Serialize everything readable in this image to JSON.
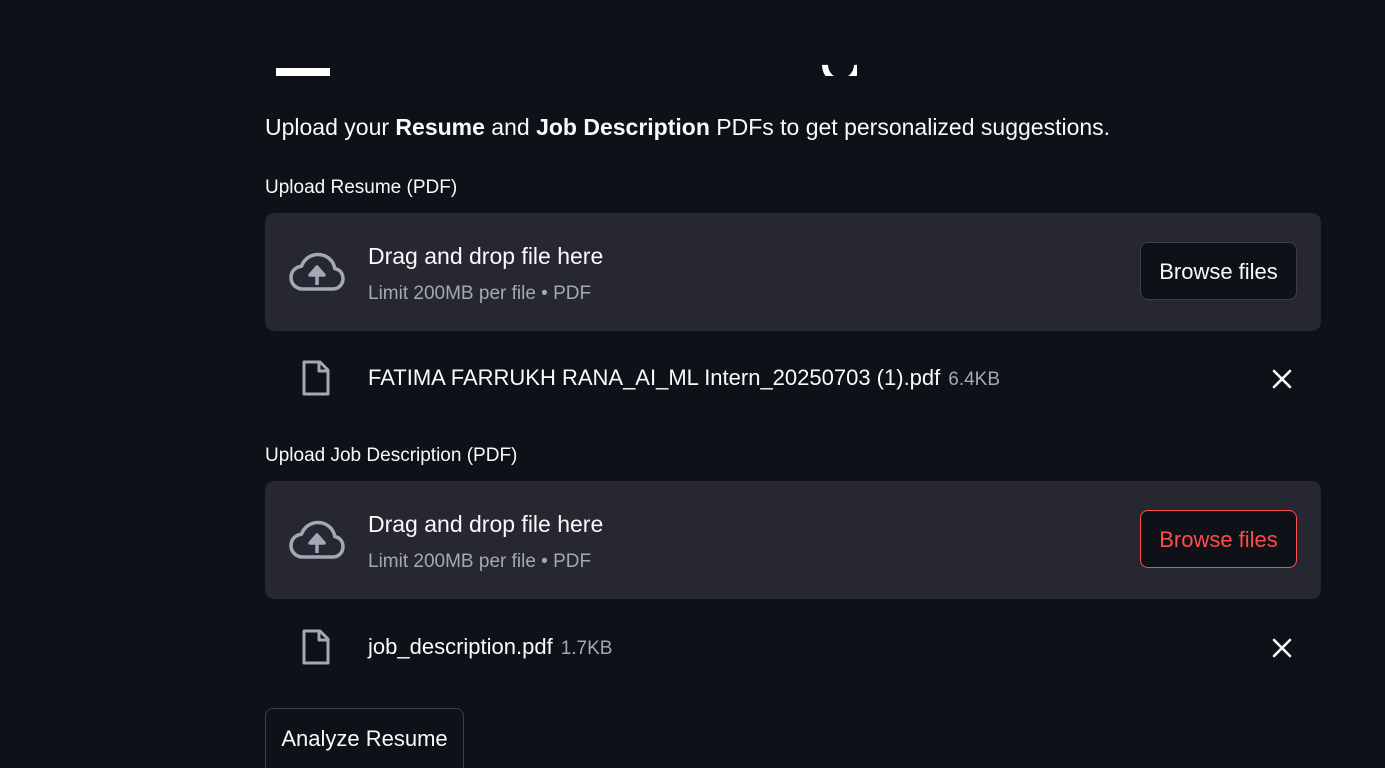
{
  "intro": {
    "prefix": "Upload your ",
    "resume_word": "Resume",
    "middle": " and ",
    "jd_word": "Job Description",
    "suffix": " PDFs to get personalized suggestions."
  },
  "resume_uploader": {
    "label": "Upload Resume (PDF)",
    "drop_title": "Drag and drop file here",
    "limit": "Limit 200MB per file • PDF",
    "browse_label": "Browse files",
    "file": {
      "name": "FATIMA FARRUKH RANA_AI_ML Intern_20250703 (1).pdf",
      "size": "6.4KB"
    }
  },
  "jd_uploader": {
    "label": "Upload Job Description (PDF)",
    "drop_title": "Drag and drop file here",
    "limit": "Limit 200MB per file • PDF",
    "browse_label": "Browse files",
    "file": {
      "name": "job_description.pdf",
      "size": "1.7KB"
    }
  },
  "analyze_label": "Analyze Resume",
  "colors": {
    "background": "#0e1117",
    "dropzone": "#262730",
    "accent": "#ff4b4b",
    "muted_text": "#a3a8b8"
  },
  "icons": [
    "cloud-upload-icon",
    "file-icon",
    "close-icon"
  ]
}
